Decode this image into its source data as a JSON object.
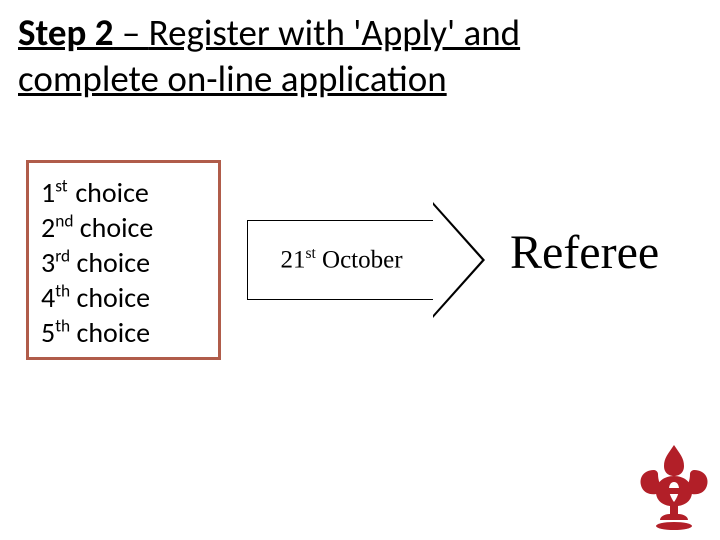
{
  "title": {
    "step_label": "Step 2",
    "dash": " – ",
    "rest": "Register with 'Apply' and complete on-line application"
  },
  "choices": [
    {
      "num": "1",
      "suf": "st",
      "word": "choice"
    },
    {
      "num": "2",
      "suf": "nd",
      "word": "choice"
    },
    {
      "num": "3",
      "suf": "rd",
      "word": "choice"
    },
    {
      "num": "4",
      "suf": "th",
      "word": "choice"
    },
    {
      "num": "5",
      "suf": "th",
      "word": "choice"
    }
  ],
  "arrow": {
    "date_num": "21",
    "date_suf": "st",
    "date_month": " October"
  },
  "referee_label": "Referee",
  "colors": {
    "box_border": "#b05c4a",
    "logo": "#b21f28"
  }
}
